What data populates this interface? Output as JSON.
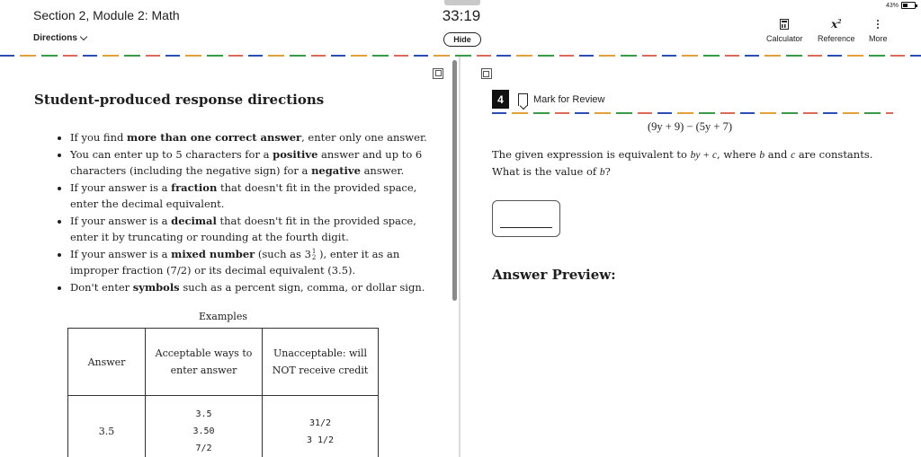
{
  "header": {
    "section_title": "Section 2, Module 2: Math",
    "directions_label": "Directions",
    "timer": "33:19",
    "hide_label": "Hide",
    "battery_percent": "43%",
    "battery_level": 0.43,
    "tools": {
      "calculator": "Calculator",
      "reference": "Reference",
      "more": "More"
    }
  },
  "directions": {
    "title": "Student-produced response directions",
    "rules": [
      [
        "If you find ",
        "more than one correct answer",
        ", enter only one answer."
      ],
      [
        "You can enter up to 5 characters for a ",
        "positive",
        " answer and up to 6 characters (including the negative sign) for a ",
        "negative",
        " answer."
      ],
      [
        "If your answer is a ",
        "fraction",
        " that doesn't fit in the provided space, enter the decimal equivalent."
      ],
      [
        "If your answer is a ",
        "decimal",
        " that doesn't fit in the provided space, enter it by truncating or rounding at the fourth digit."
      ],
      [
        "If your answer is a ",
        "mixed number",
        " (such as 3",
        "1",
        "2",
        " ), enter it as an improper fraction (7/2) or its decimal equivalent (3.5)."
      ],
      [
        "Don't enter ",
        "symbols",
        " such as a percent sign, comma, or dollar sign."
      ]
    ],
    "examples_caption": "Examples",
    "table": {
      "headers": [
        "Answer",
        "Acceptable ways to enter answer",
        "Unacceptable: will NOT receive credit"
      ],
      "rows": [
        {
          "answer": "3.5",
          "acceptable": [
            "3.5",
            "3.50",
            "7/2"
          ],
          "unacceptable": [
            "31/2",
            "3 1/2"
          ]
        }
      ]
    }
  },
  "question": {
    "number": "4",
    "mark_label": "Mark for Review",
    "expression": "(9y + 9) − (5y + 7)",
    "prompt_parts": [
      "The given expression is equivalent to ",
      "by + c",
      ", where ",
      "b",
      " and ",
      "c",
      " are constants. What is the value of ",
      "b",
      "?"
    ],
    "answer_value": "",
    "answer_preview_label": "Answer Preview:"
  }
}
